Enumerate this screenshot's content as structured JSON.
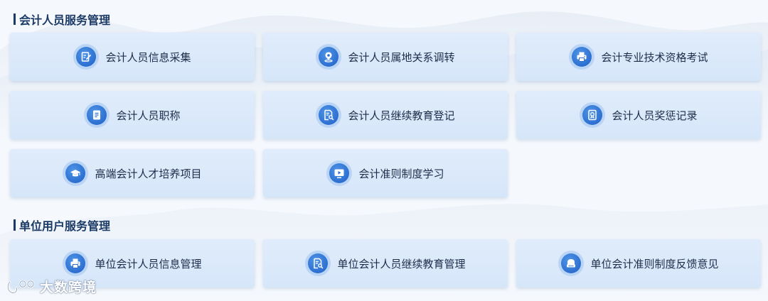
{
  "sections": [
    {
      "title": "会计人员服务管理",
      "items": [
        {
          "label": "会计人员信息采集",
          "icon": "edit-doc-icon"
        },
        {
          "label": "会计人员属地关系调转",
          "icon": "location-pin-icon"
        },
        {
          "label": "会计专业技术资格考试",
          "icon": "printer-icon"
        },
        {
          "label": "会计人员职称",
          "icon": "certificate-icon"
        },
        {
          "label": "会计人员继续教育登记",
          "icon": "doc-search-icon"
        },
        {
          "label": "会计人员奖惩记录",
          "icon": "award-doc-icon"
        },
        {
          "label": "高端会计人才培养项目",
          "icon": "graduation-cap-icon"
        },
        {
          "label": "会计准则制度学习",
          "icon": "video-play-icon"
        }
      ]
    },
    {
      "title": "单位用户服务管理",
      "items": [
        {
          "label": "单位会计人员信息管理",
          "icon": "printer-icon"
        },
        {
          "label": "单位会计人员继续教育管理",
          "icon": "doc-search-icon"
        },
        {
          "label": "单位会计准则制度反馈意见",
          "icon": "chat-icon"
        }
      ]
    }
  ],
  "watermark": {
    "text": "大数跨境"
  },
  "colors": {
    "title": "#1b3a66",
    "card_bg": "#dbe8fa",
    "icon_bg": "#2c6fd1",
    "icon_ring": "#b9d4f4",
    "label": "#1d2d4a"
  }
}
